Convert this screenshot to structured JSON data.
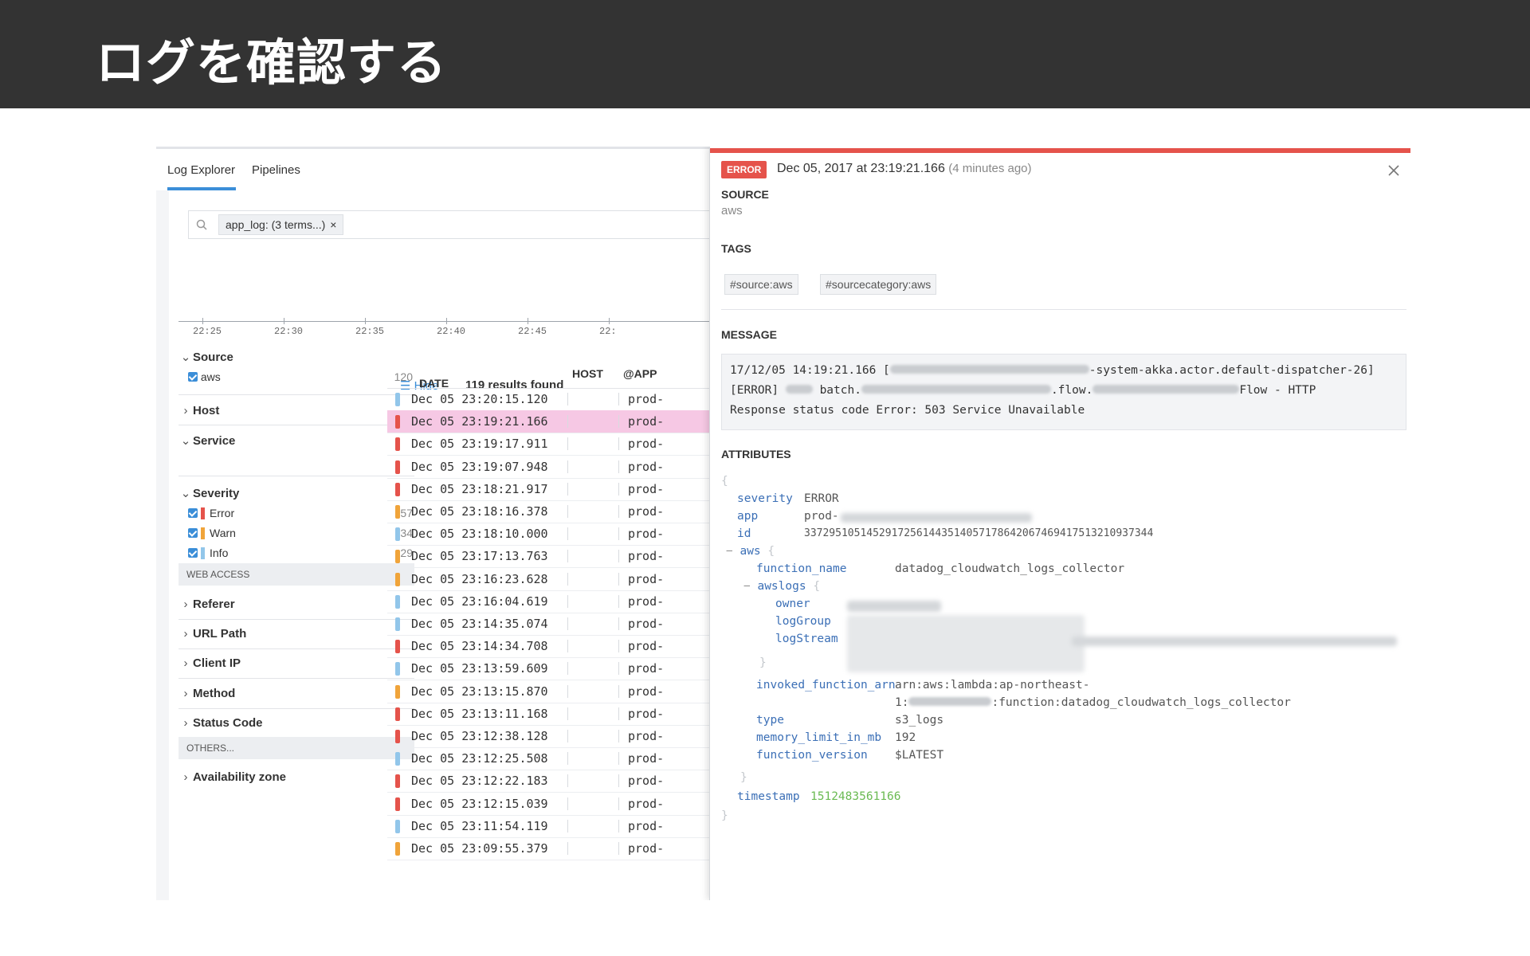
{
  "slide": {
    "title": "ログを確認する"
  },
  "tabs": [
    {
      "label": "Log Explorer",
      "active": true
    },
    {
      "label": "Pipelines",
      "active": false
    }
  ],
  "search": {
    "chip": "app_log: (3 terms...)",
    "chip_close": "×"
  },
  "timeline": {
    "ticks": [
      "22:25",
      "22:30",
      "22:35",
      "22:40",
      "22:45",
      "22:"
    ]
  },
  "facets": {
    "source": {
      "label": "Source",
      "items": [
        {
          "label": "aws",
          "count": "120"
        }
      ]
    },
    "host": {
      "label": "Host"
    },
    "service": {
      "label": "Service"
    },
    "severity": {
      "label": "Severity",
      "items": [
        {
          "label": "Error",
          "count": "57",
          "color": "#e5534b"
        },
        {
          "label": "Warn",
          "count": "34",
          "color": "#f0a43a"
        },
        {
          "label": "Info",
          "count": "29",
          "color": "#92c6ea"
        }
      ]
    },
    "web_access": {
      "header": "WEB ACCESS",
      "items": [
        "Referer",
        "URL Path",
        "Client IP",
        "Method",
        "Status Code"
      ]
    },
    "others": {
      "header": "OTHERS...",
      "items": [
        "Availability zone"
      ]
    }
  },
  "results": {
    "hide": "Hide",
    "count": "119 results found",
    "columns": [
      "DATE",
      "HOST",
      "@APP"
    ],
    "rows": [
      {
        "date": "Dec 05 23:20:15.120",
        "app": "prod-",
        "level": "info"
      },
      {
        "date": "Dec 05 23:19:21.166",
        "app": "prod-",
        "level": "error",
        "selected": true
      },
      {
        "date": "Dec 05 23:19:17.911",
        "app": "prod-",
        "level": "error"
      },
      {
        "date": "Dec 05 23:19:07.948",
        "app": "prod-",
        "level": "error"
      },
      {
        "date": "Dec 05 23:18:21.917",
        "app": "prod-",
        "level": "error"
      },
      {
        "date": "Dec 05 23:18:16.378",
        "app": "prod-",
        "level": "warn"
      },
      {
        "date": "Dec 05 23:18:10.000",
        "app": "prod-",
        "level": "info"
      },
      {
        "date": "Dec 05 23:17:13.763",
        "app": "prod-",
        "level": "warn"
      },
      {
        "date": "Dec 05 23:16:23.628",
        "app": "prod-",
        "level": "warn"
      },
      {
        "date": "Dec 05 23:16:04.619",
        "app": "prod-",
        "level": "info"
      },
      {
        "date": "Dec 05 23:14:35.074",
        "app": "prod-",
        "level": "info"
      },
      {
        "date": "Dec 05 23:14:34.708",
        "app": "prod-",
        "level": "error"
      },
      {
        "date": "Dec 05 23:13:59.609",
        "app": "prod-",
        "level": "info"
      },
      {
        "date": "Dec 05 23:13:15.870",
        "app": "prod-",
        "level": "warn"
      },
      {
        "date": "Dec 05 23:13:11.168",
        "app": "prod-",
        "level": "error"
      },
      {
        "date": "Dec 05 23:12:38.128",
        "app": "prod-",
        "level": "error"
      },
      {
        "date": "Dec 05 23:12:25.508",
        "app": "prod-",
        "level": "info"
      },
      {
        "date": "Dec 05 23:12:22.183",
        "app": "prod-",
        "level": "error"
      },
      {
        "date": "Dec 05 23:12:15.039",
        "app": "prod-",
        "level": "error"
      },
      {
        "date": "Dec 05 23:11:54.119",
        "app": "prod-",
        "level": "info"
      },
      {
        "date": "Dec 05 23:09:55.379",
        "app": "prod-",
        "level": "warn"
      }
    ]
  },
  "detail": {
    "status": "ERROR",
    "date": "Dec 05, 2017 at 23:19:21.166",
    "ago": "(4 minutes ago)",
    "source_label": "SOURCE",
    "source_value": "aws",
    "tags_label": "TAGS",
    "tags": [
      "#source:aws",
      "#sourcecategory:aws"
    ],
    "message_label": "MESSAGE",
    "message": {
      "l1a": "17/12/05 14:19:21.166 [",
      "l1b": "-system-akka.actor.default-dispatcher-26]",
      "l2a": "[ERROR] ",
      "l2b": " batch.",
      "l2c": ".flow.",
      "l2d": "Flow - HTTP",
      "l3": "Response status code Error: 503 Service Unavailable"
    },
    "attributes_label": "ATTRIBUTES",
    "attributes": {
      "severity_k": "severity",
      "severity_v": "ERROR",
      "app_k": "app",
      "app_v": "prod-",
      "id_k": "id",
      "id_v": "33729510514529172561443514057178642067469417513210937344",
      "aws_k": "aws",
      "function_name_k": "function_name",
      "function_name_v": "datadog_cloudwatch_logs_collector",
      "awslogs_k": "awslogs",
      "owner_k": "owner",
      "loggroup_k": "logGroup",
      "logstream_k": "logStream",
      "arn_k": "invoked_function_arn",
      "arn_v1": "arn:aws:lambda:ap-northeast-",
      "arn_v2a": "1:",
      "arn_v2b": ":function:datadog_cloudwatch_logs_collector",
      "type_k": "type",
      "type_v": "s3_logs",
      "mem_k": "memory_limit_in_mb",
      "mem_v": "192",
      "fver_k": "function_version",
      "fver_v": "$LATEST",
      "ts_k": "timestamp",
      "ts_v": "1512483561166"
    }
  },
  "colors": {
    "error": "#e5534b",
    "warn": "#f0a43a",
    "info": "#92c6ea",
    "accent": "#3b8ed8",
    "header_bg": "#333333"
  }
}
